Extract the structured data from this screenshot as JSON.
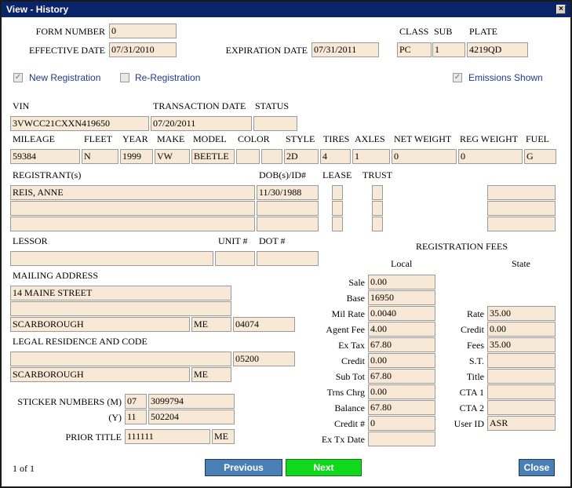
{
  "window": {
    "title": "View - History",
    "close_glyph": "×"
  },
  "form": {
    "form_number_label": "FORM NUMBER",
    "form_number": "0",
    "effective_date_label": "EFFECTIVE DATE",
    "effective_date": "07/31/2010",
    "expiration_date_label": "EXPIRATION DATE",
    "expiration_date": "07/31/2011",
    "class_label": "CLASS",
    "class": "PC",
    "sub_label": "SUB",
    "sub": "1",
    "plate_label": "PLATE",
    "plate": "4219QD"
  },
  "checks": {
    "new_registration": "New Registration",
    "re_registration": "Re-Registration",
    "emissions_shown": "Emissions Shown"
  },
  "vehicle": {
    "vin_label": "VIN",
    "vin": "3VWCC21CXXN419650",
    "transaction_date_label": "TRANSACTION DATE",
    "transaction_date": "07/20/2011",
    "status_label": "STATUS",
    "status": "",
    "mileage_label": "MILEAGE",
    "mileage": "59384",
    "fleet_label": "FLEET",
    "fleet": "N",
    "year_label": "YEAR",
    "year": "1999",
    "make_label": "MAKE",
    "make": "VW",
    "model_label": "MODEL",
    "model": "BEETLE",
    "color_label": "COLOR",
    "color": "",
    "style_label": "STYLE",
    "style": "2D",
    "tires_label": "TIRES",
    "tires": "4",
    "axles_label": "AXLES",
    "axles": "1",
    "net_weight_label": "NET WEIGHT",
    "net_weight": "0",
    "reg_weight_label": "REG WEIGHT",
    "reg_weight": "0",
    "fuel_label": "FUEL",
    "fuel": "G"
  },
  "registrant": {
    "label": "REGISTRANT(s)",
    "dob_label": "DOB(s)/ID#",
    "lease_label": "LEASE",
    "trust_label": "TRUST",
    "name1": "REIS, ANNE",
    "dob1": "11/30/1988"
  },
  "lessor": {
    "label": "LESSOR",
    "unit_label": "UNIT #",
    "dot_label": "DOT #"
  },
  "mailing": {
    "label": "MAILING ADDRESS",
    "line1": "14 MAINE STREET",
    "city": "SCARBOROUGH",
    "state": "ME",
    "zip": "04074"
  },
  "legal": {
    "label": "LEGAL RESIDENCE AND CODE",
    "code": "05200",
    "city": "SCARBOROUGH",
    "state": "ME"
  },
  "stickers": {
    "m_label": "STICKER NUMBERS (M)",
    "m_year": "07",
    "m_number": "3099794",
    "y_label": "(Y)",
    "y_year": "11",
    "y_number": "502204",
    "prior_title_label": "PRIOR TITLE",
    "prior_title": "111111",
    "prior_state": "ME"
  },
  "fees": {
    "title": "REGISTRATION FEES",
    "local_label": "Local",
    "state_label": "State",
    "sale_label": "Sale",
    "sale": "0.00",
    "base_label": "Base",
    "base": "16950",
    "mil_rate_label": "Mil Rate",
    "mil_rate": "0.0040",
    "agent_fee_label": "Agent Fee",
    "agent_fee": "4.00",
    "ex_tax_label": "Ex Tax",
    "ex_tax": "67.80",
    "credit_label": "Credit",
    "credit": "0.00",
    "sub_tot_label": "Sub Tot",
    "sub_tot": "67.80",
    "trns_chrg_label": "Trns Chrg",
    "trns_chrg": "0.00",
    "balance_label": "Balance",
    "balance": "67.80",
    "credit_no_label": "Credit #",
    "credit_no": "0",
    "ex_tx_date_label": "Ex Tx Date",
    "ex_tx_date": "",
    "rate_label": "Rate",
    "rate": "35.00",
    "s_credit_label": "Credit",
    "s_credit": "0.00",
    "fees_label": "Fees",
    "fees": "35.00",
    "st_label": "S.T.",
    "title_label": "Title",
    "cta1_label": "CTA 1",
    "cta2_label": "CTA 2",
    "user_id_label": "User ID",
    "user_id": "ASR"
  },
  "footer": {
    "page": "1 of 1",
    "previous": "Previous",
    "next": "Next",
    "close": "Close"
  }
}
